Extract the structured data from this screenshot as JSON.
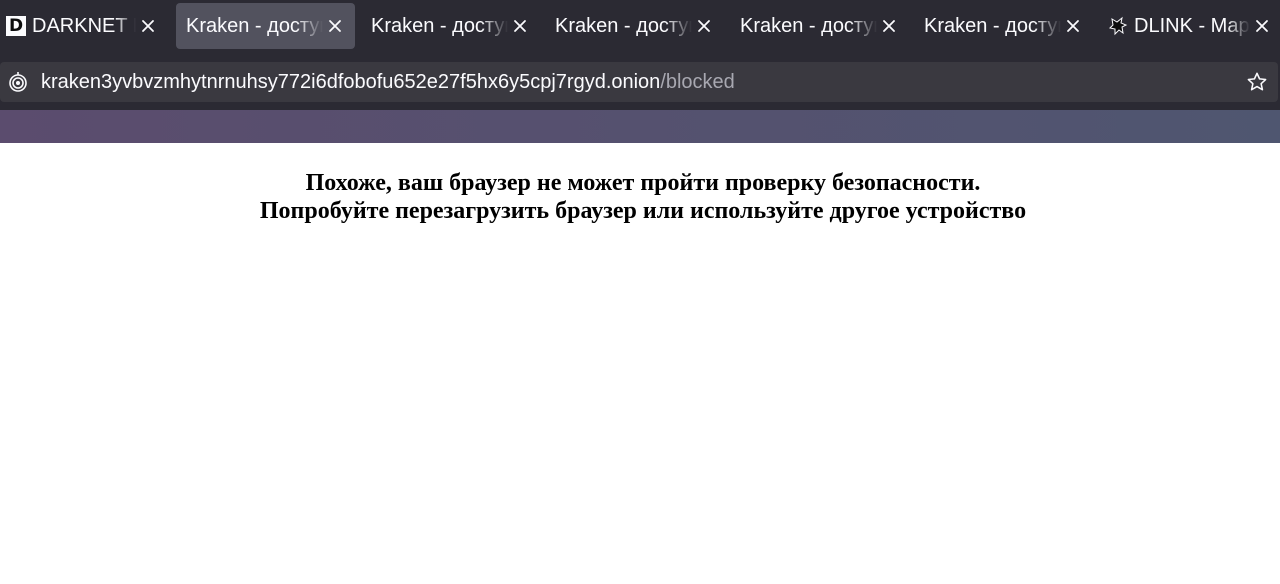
{
  "tabs": [
    {
      "title": "DARKNET DLINK",
      "favicon": "D",
      "active": false
    },
    {
      "title": "Kraken - доступ",
      "active": true
    },
    {
      "title": "Kraken - доступ",
      "active": false
    },
    {
      "title": "Kraken - доступ",
      "active": false
    },
    {
      "title": "Kraken - доступ",
      "active": false
    },
    {
      "title": "Kraken - доступ",
      "active": false
    },
    {
      "title": "DLINK - Map",
      "favicon": "paw-icon",
      "active": false
    }
  ],
  "urlbar": {
    "host": "kraken3yvbvzmhytnrnuhsy772i6dfobofu652e27f5hx6y5cpj7rgyd.onion",
    "path": "/blocked",
    "security_icon": "onion-icon",
    "bookmark_icon": "star-icon"
  },
  "page": {
    "line1": "Похоже, ваш браузер не может пройти проверку безопасности.",
    "line2": "Попробуйте перезагрузить браузер или используйте другое устройство"
  },
  "colors": {
    "chrome": "#2b2a33",
    "active_tab": "#52525e",
    "urlbar": "#3a3940",
    "banner_left": "#5b4c6e",
    "banner_right": "#4f5670"
  }
}
